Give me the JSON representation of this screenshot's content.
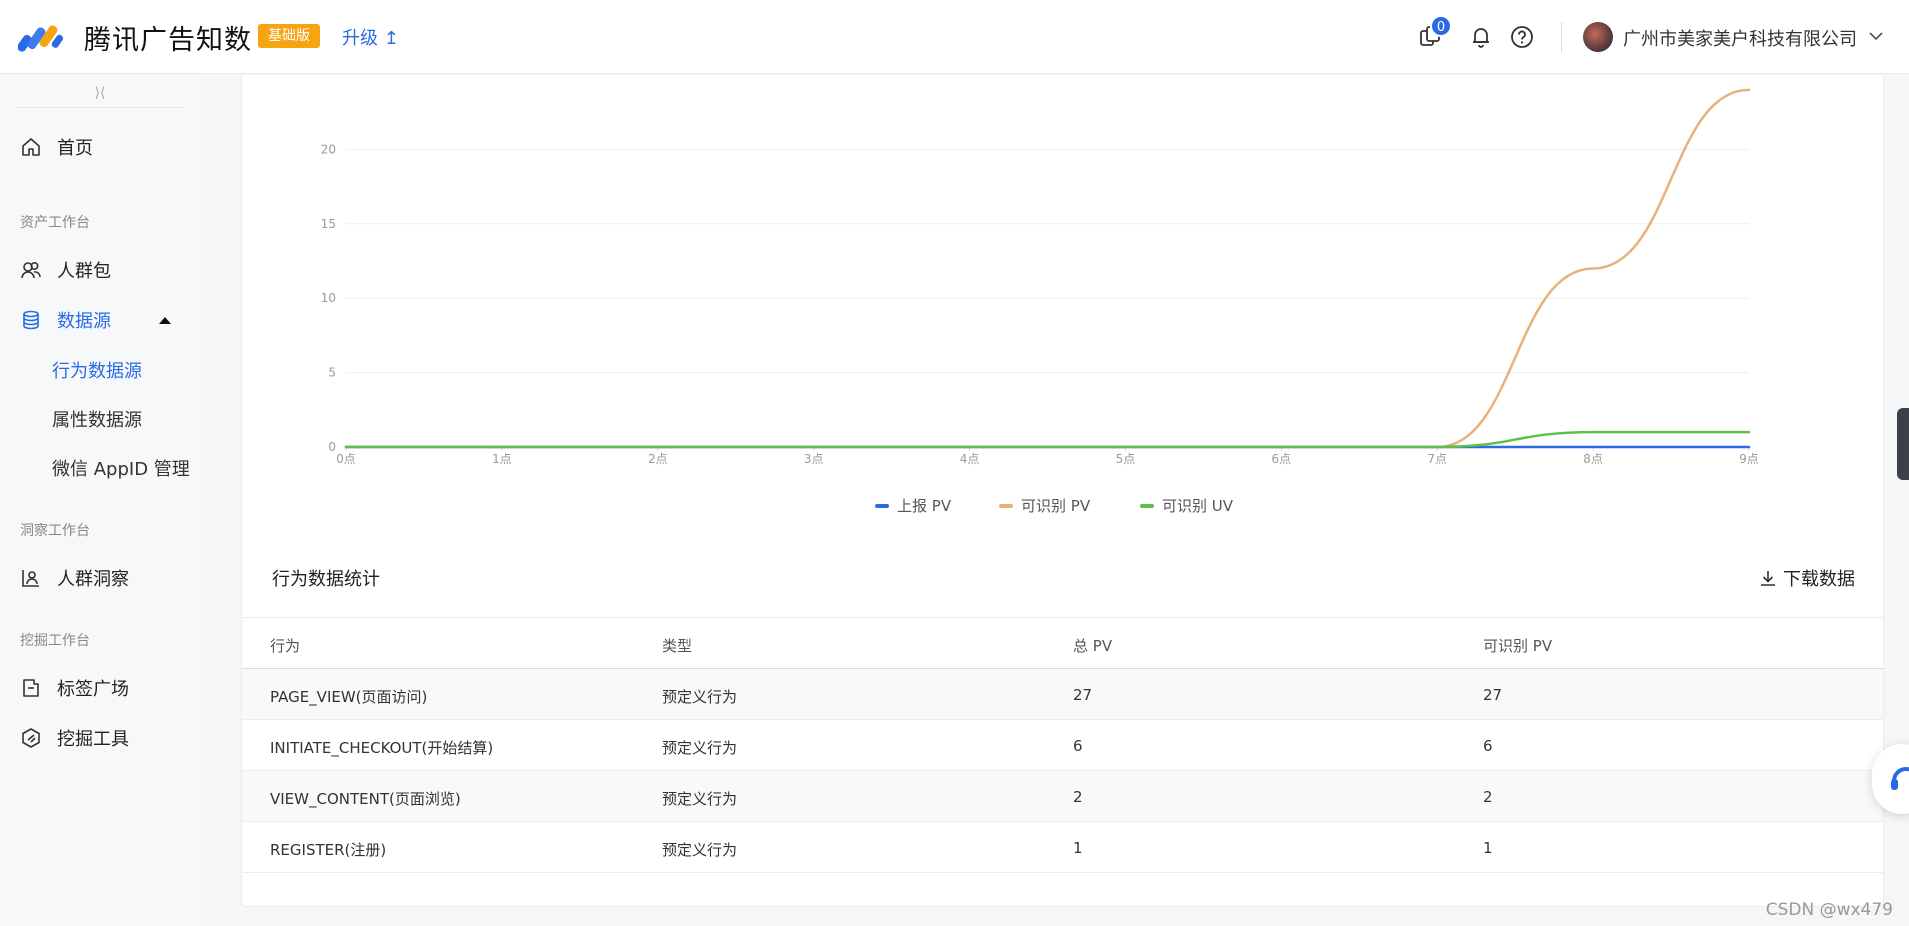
{
  "header": {
    "app_title": "腾讯广告知数",
    "edition_badge": "基础版",
    "upgrade_label": "升级",
    "message_count": "0",
    "company_name": "广州市美家美户科技有限公司"
  },
  "sidebar": {
    "collapse_glyph": "⟩⟨",
    "home": "首页",
    "groups": {
      "asset": "资产工作台",
      "insight": "洞察工作台",
      "mining": "挖掘工作台"
    },
    "audience_pack": "人群包",
    "data_source": "数据源",
    "sub_items": [
      "行为数据源",
      "属性数据源",
      "微信 AppID 管理"
    ],
    "audience_insight": "人群洞察",
    "tag_square": "标签广场",
    "mining_tool": "挖掘工具"
  },
  "colors": {
    "accent": "#2a6be3",
    "series_reported_pv": "#2a6be3",
    "series_identified_pv": "#e8b17a",
    "series_identified_uv": "#5fbf4a"
  },
  "chart_data": {
    "type": "line",
    "x": [
      "0点",
      "1点",
      "2点",
      "3点",
      "4点",
      "5点",
      "6点",
      "7点",
      "8点",
      "9点"
    ],
    "yticks": [
      0,
      5,
      10,
      15,
      20
    ],
    "ylim": [
      0,
      25
    ],
    "grid": true,
    "legend_position": "bottom-center",
    "series": [
      {
        "name": "上报 PV",
        "values": [
          0,
          0,
          0,
          0,
          0,
          0,
          0,
          0,
          0,
          0
        ]
      },
      {
        "name": "可识别 PV",
        "values": [
          0,
          0,
          0,
          0,
          0,
          0,
          0,
          0,
          12,
          24
        ]
      },
      {
        "name": "可识别 UV",
        "values": [
          0,
          0,
          0,
          0,
          0,
          0,
          0,
          0,
          1,
          1
        ]
      }
    ]
  },
  "table": {
    "title": "行为数据统计",
    "download_label": "下载数据",
    "columns": [
      "行为",
      "类型",
      "总 PV",
      "可识别 PV"
    ],
    "rows": [
      [
        "PAGE_VIEW(页面访问)",
        "预定义行为",
        "27",
        "27"
      ],
      [
        "INITIATE_CHECKOUT(开始结算)",
        "预定义行为",
        "6",
        "6"
      ],
      [
        "VIEW_CONTENT(页面浏览)",
        "预定义行为",
        "2",
        "2"
      ],
      [
        "REGISTER(注册)",
        "预定义行为",
        "1",
        "1"
      ]
    ]
  },
  "watermark": "CSDN @wx479"
}
